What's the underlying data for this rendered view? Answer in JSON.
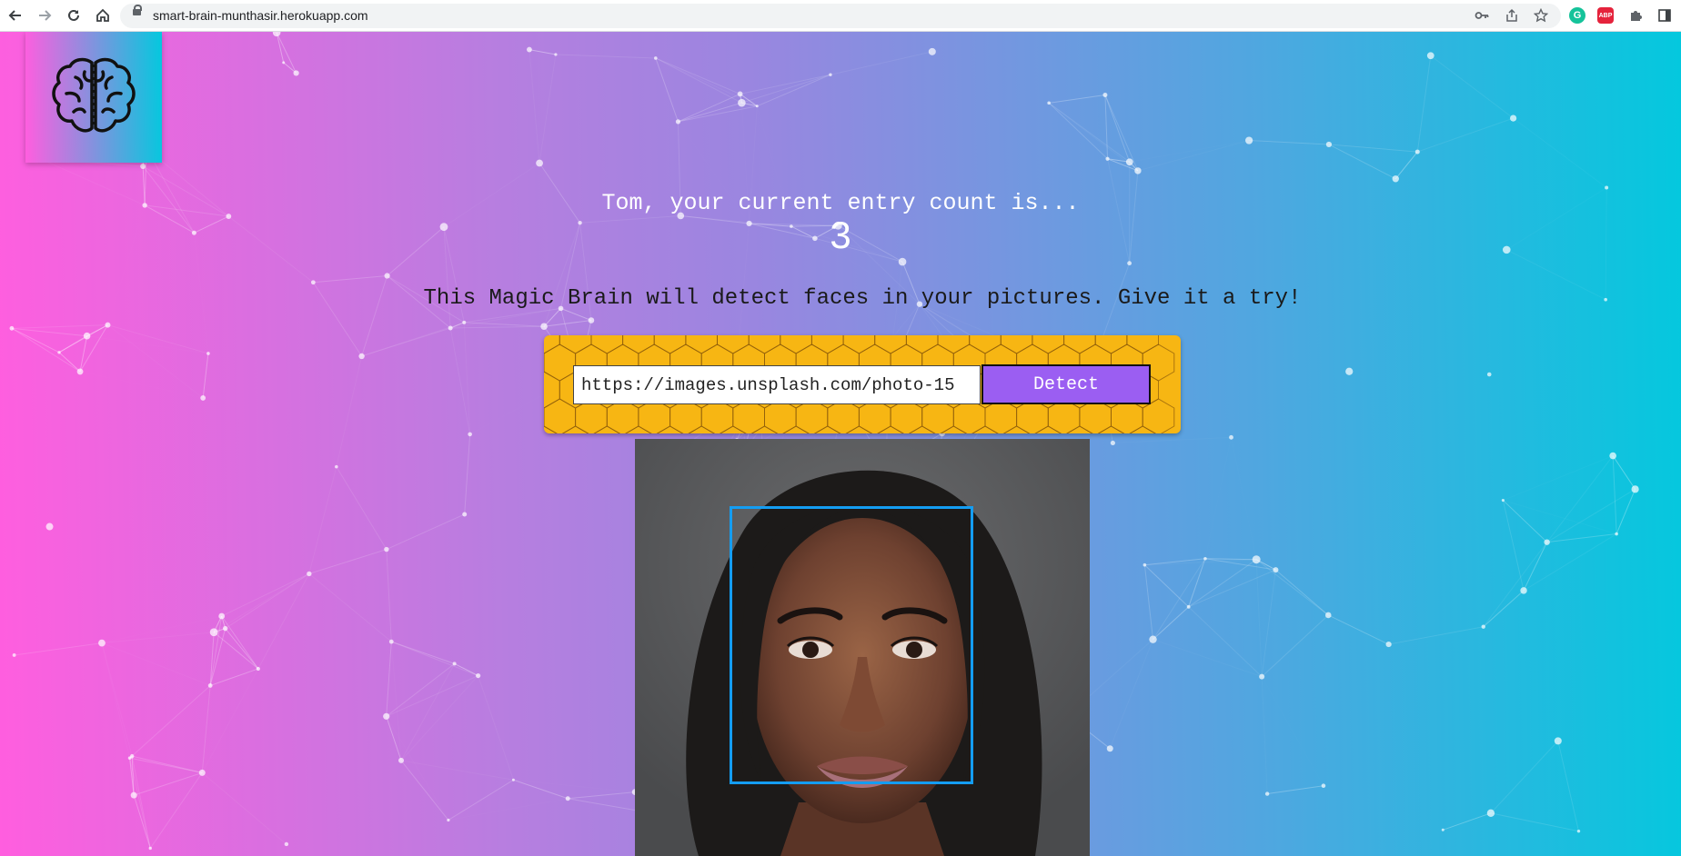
{
  "browser": {
    "url": "smart-brain-munthasir.herokuapp.com",
    "nav_icons": [
      "back-arrow-icon",
      "forward-arrow-icon",
      "reload-icon",
      "home-icon"
    ],
    "toolbar_icons": [
      "key-icon",
      "share-icon",
      "star-icon",
      "grammarly-icon",
      "adblock-icon",
      "puzzle-extension-icon",
      "side-panel-icon"
    ],
    "grammarly_letter": "G",
    "adblock_letters": "ABP"
  },
  "page": {
    "entry_text": "Tom, your current entry count is...",
    "entry_count": "3",
    "intro_text": "This Magic Brain will detect faces in your pictures. Give it a try!",
    "image_url_value": "https://images.unsplash.com/photo-15",
    "detect_label": "Detect"
  },
  "colors": {
    "gradient_start": "#ff5edf",
    "gradient_end": "#04c8de",
    "form_background": "#f7b613",
    "detect_button": "#9b5ef2",
    "face_box": "#149df2"
  }
}
